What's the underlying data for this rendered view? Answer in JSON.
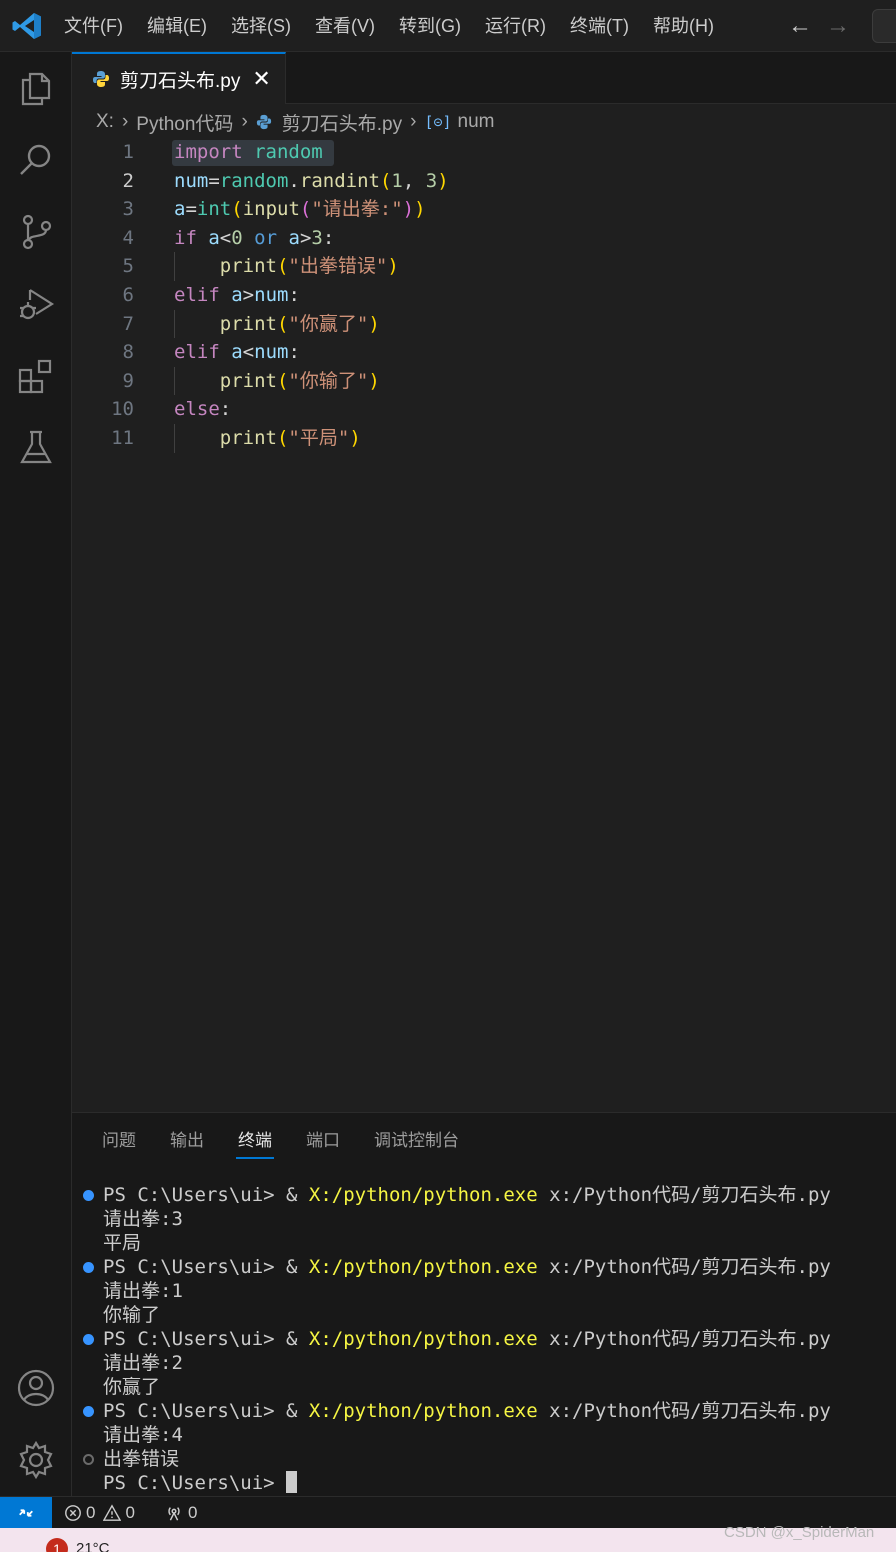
{
  "menu": [
    "文件(F)",
    "编辑(E)",
    "选择(S)",
    "查看(V)",
    "转到(G)",
    "运行(R)",
    "终端(T)",
    "帮助(H)"
  ],
  "nav": {
    "back_icon": "arrow-left-icon",
    "forward_icon": "arrow-right-icon"
  },
  "tab": {
    "title": "剪刀石头布.py",
    "close": "✕"
  },
  "breadcrumb": {
    "drive": "X:",
    "folder": "Python代码",
    "file": "剪刀石头布.py",
    "symbol_icon": "[⊝]",
    "symbol": "num"
  },
  "editor": {
    "active_line": 2,
    "line_numbers": [
      "1",
      "2",
      "3",
      "4",
      "5",
      "6",
      "7",
      "8",
      "9",
      "10",
      "11"
    ],
    "lines": [
      [
        {
          "t": "import",
          "c": "kw"
        },
        {
          "t": " ",
          "c": "op"
        },
        {
          "t": "random",
          "c": "mod"
        }
      ],
      [
        {
          "t": "num",
          "c": "var"
        },
        {
          "t": "=",
          "c": "op"
        },
        {
          "t": "random",
          "c": "mod"
        },
        {
          "t": ".",
          "c": "op"
        },
        {
          "t": "randint",
          "c": "fn"
        },
        {
          "t": "(",
          "c": "paren1"
        },
        {
          "t": "1",
          "c": "num"
        },
        {
          "t": ", ",
          "c": "op"
        },
        {
          "t": "3",
          "c": "num"
        },
        {
          "t": ")",
          "c": "paren1"
        }
      ],
      [
        {
          "t": "a",
          "c": "var"
        },
        {
          "t": "=",
          "c": "op"
        },
        {
          "t": "int",
          "c": "mod"
        },
        {
          "t": "(",
          "c": "paren1"
        },
        {
          "t": "input",
          "c": "fn"
        },
        {
          "t": "(",
          "c": "paren2"
        },
        {
          "t": "\"请出拳:\"",
          "c": "str"
        },
        {
          "t": ")",
          "c": "paren2"
        },
        {
          "t": ")",
          "c": "paren1"
        }
      ],
      [
        {
          "t": "if",
          "c": "kw"
        },
        {
          "t": " ",
          "c": "op"
        },
        {
          "t": "a",
          "c": "var"
        },
        {
          "t": "<",
          "c": "op"
        },
        {
          "t": "0",
          "c": "num"
        },
        {
          "t": " ",
          "c": "op"
        },
        {
          "t": "or",
          "c": "kw2"
        },
        {
          "t": " ",
          "c": "op"
        },
        {
          "t": "a",
          "c": "var"
        },
        {
          "t": ">",
          "c": "op"
        },
        {
          "t": "3",
          "c": "num"
        },
        {
          "t": ":",
          "c": "op"
        }
      ],
      [
        {
          "t": "    ",
          "c": "op"
        },
        {
          "t": "print",
          "c": "fn"
        },
        {
          "t": "(",
          "c": "paren1"
        },
        {
          "t": "\"出拳错误\"",
          "c": "str"
        },
        {
          "t": ")",
          "c": "paren1"
        }
      ],
      [
        {
          "t": "elif",
          "c": "kw"
        },
        {
          "t": " ",
          "c": "op"
        },
        {
          "t": "a",
          "c": "var"
        },
        {
          "t": ">",
          "c": "op"
        },
        {
          "t": "num",
          "c": "var"
        },
        {
          "t": ":",
          "c": "op"
        }
      ],
      [
        {
          "t": "    ",
          "c": "op"
        },
        {
          "t": "print",
          "c": "fn"
        },
        {
          "t": "(",
          "c": "paren1"
        },
        {
          "t": "\"你赢了\"",
          "c": "str"
        },
        {
          "t": ")",
          "c": "paren1"
        }
      ],
      [
        {
          "t": "elif",
          "c": "kw"
        },
        {
          "t": " ",
          "c": "op"
        },
        {
          "t": "a",
          "c": "var"
        },
        {
          "t": "<",
          "c": "op"
        },
        {
          "t": "num",
          "c": "var"
        },
        {
          "t": ":",
          "c": "op"
        }
      ],
      [
        {
          "t": "    ",
          "c": "op"
        },
        {
          "t": "print",
          "c": "fn"
        },
        {
          "t": "(",
          "c": "paren1"
        },
        {
          "t": "\"你输了\"",
          "c": "str"
        },
        {
          "t": ")",
          "c": "paren1"
        }
      ],
      [
        {
          "t": "else",
          "c": "kw"
        },
        {
          "t": ":",
          "c": "op"
        }
      ],
      [
        {
          "t": "    ",
          "c": "op"
        },
        {
          "t": "print",
          "c": "fn"
        },
        {
          "t": "(",
          "c": "paren1"
        },
        {
          "t": "\"平局\"",
          "c": "str"
        },
        {
          "t": ")",
          "c": "paren1"
        }
      ]
    ]
  },
  "panel": {
    "tabs": [
      "问题",
      "输出",
      "终端",
      "端口",
      "调试控制台"
    ],
    "active_tab": "终端",
    "terminal": [
      {
        "dot": "filled",
        "prompt": "PS C:\\Users\\ui> & ",
        "exe": "X:/python/python.exe",
        "arg": " x:/Python代码/剪刀石头布.py"
      },
      {
        "text": "请出拳:3"
      },
      {
        "text": "平局"
      },
      {
        "dot": "filled",
        "prompt": "PS C:\\Users\\ui> & ",
        "exe": "X:/python/python.exe",
        "arg": " x:/Python代码/剪刀石头布.py"
      },
      {
        "text": "请出拳:1"
      },
      {
        "text": "你输了"
      },
      {
        "dot": "filled",
        "prompt": "PS C:\\Users\\ui> & ",
        "exe": "X:/python/python.exe",
        "arg": " x:/Python代码/剪刀石头布.py"
      },
      {
        "text": "请出拳:2"
      },
      {
        "text": "你赢了"
      },
      {
        "dot": "filled",
        "prompt": "PS C:\\Users\\ui> & ",
        "exe": "X:/python/python.exe",
        "arg": " x:/Python代码/剪刀石头布.py"
      },
      {
        "text": "请出拳:4"
      },
      {
        "dot": "hollow",
        "text": "出拳错误"
      },
      {
        "text": "PS C:\\Users\\ui> ",
        "cursor": true
      }
    ]
  },
  "status": {
    "remote_icon": "remote-icon",
    "errors": "0",
    "warnings": "0",
    "ports": "0"
  },
  "taskbar": {
    "badge": "1",
    "temp": "21°C"
  },
  "watermark": "CSDN @x_SpiderMan",
  "colors": {
    "accent": "#0078d4",
    "editor_bg": "#1f1f1f",
    "sidebar_bg": "#181818",
    "terminal_exe": "#f5f543",
    "terminal_dot": "#3794ff"
  }
}
